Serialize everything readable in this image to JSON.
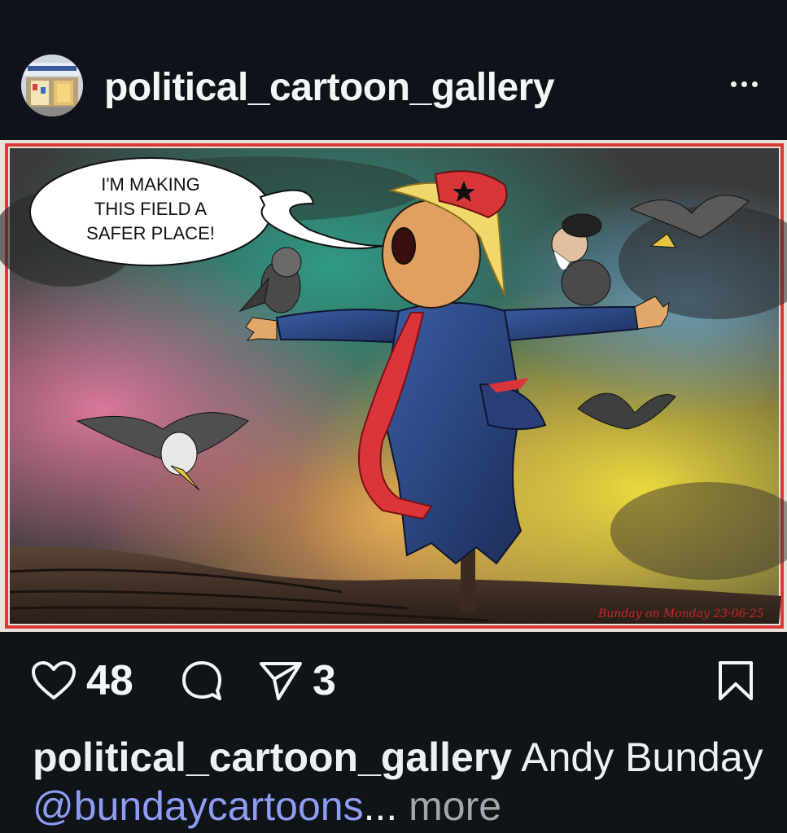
{
  "post": {
    "username": "political_cartoon_gallery",
    "image": {
      "speech_bubble_lines": [
        "I'M MAKING",
        "THIS FIELD A",
        "SAFER PLACE!"
      ],
      "signature": "Bunday on Monday 23·06·25"
    },
    "likes": "48",
    "shares": "3",
    "caption": {
      "user": "political_cartoon_gallery",
      "text": " Andy Bunday ",
      "mention": "@bundaycartoons",
      "ellipsis": "...",
      "more_label": " more"
    }
  },
  "icons": [
    "more-options-icon",
    "heart-icon",
    "comment-icon",
    "share-icon",
    "bookmark-icon"
  ],
  "colors": {
    "background": "#0f1419",
    "text": "#f4f5f6",
    "mention": "#8f9cf3",
    "muted": "#a3a7ad",
    "frame_red": "#d93a35"
  }
}
